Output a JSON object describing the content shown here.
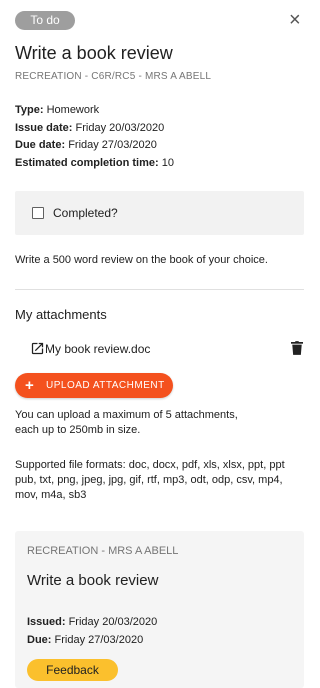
{
  "status_chip": "To do",
  "title": "Write a book review",
  "subtitle": "RECREATION - C6R/RC5 - MRS A ABELL",
  "details": {
    "type_label": "Type:",
    "type_value": "Homework",
    "issue_label": "Issue date:",
    "issue_value": "Friday 20/03/2020",
    "due_label": "Due date:",
    "due_value": "Friday 27/03/2020",
    "est_label": "Estimated completion time:",
    "est_value": "10"
  },
  "completed_label": "Completed?",
  "instructions": "Write a 500 word review on the book of your choice.",
  "attachments": {
    "heading": "My attachments",
    "items": [
      {
        "name": "My book review.doc"
      }
    ],
    "upload_label": "UPLOAD ATTACHMENT",
    "limits_line1": "You can upload a maximum of 5 attachments,",
    "limits_line2": "each up to 250mb in size.",
    "formats_line1": "Supported file formats: doc, docx, pdf, xls, xlsx, ppt, ppt",
    "formats_line2": "pub, txt, png, jpeg, jpg, gif, rtf, mp3, odt, odp, csv, mp4,",
    "formats_line3": "mov, m4a, sb3"
  },
  "card": {
    "subtitle": "RECREATION - MRS A ABELL",
    "title": "Write a book review",
    "issued_label": "Issued:",
    "issued_value": "Friday 20/03/2020",
    "due_label": "Due:",
    "due_value": "Friday 27/03/2020",
    "feedback_label": "Feedback"
  },
  "icons": {
    "close": "close-icon",
    "external": "open-in-new-icon",
    "trash": "trash-icon",
    "plus": "plus-icon"
  },
  "colors": {
    "chip": "#9e9e9e",
    "upload": "#f4511e",
    "feedback": "#fbc02d"
  }
}
